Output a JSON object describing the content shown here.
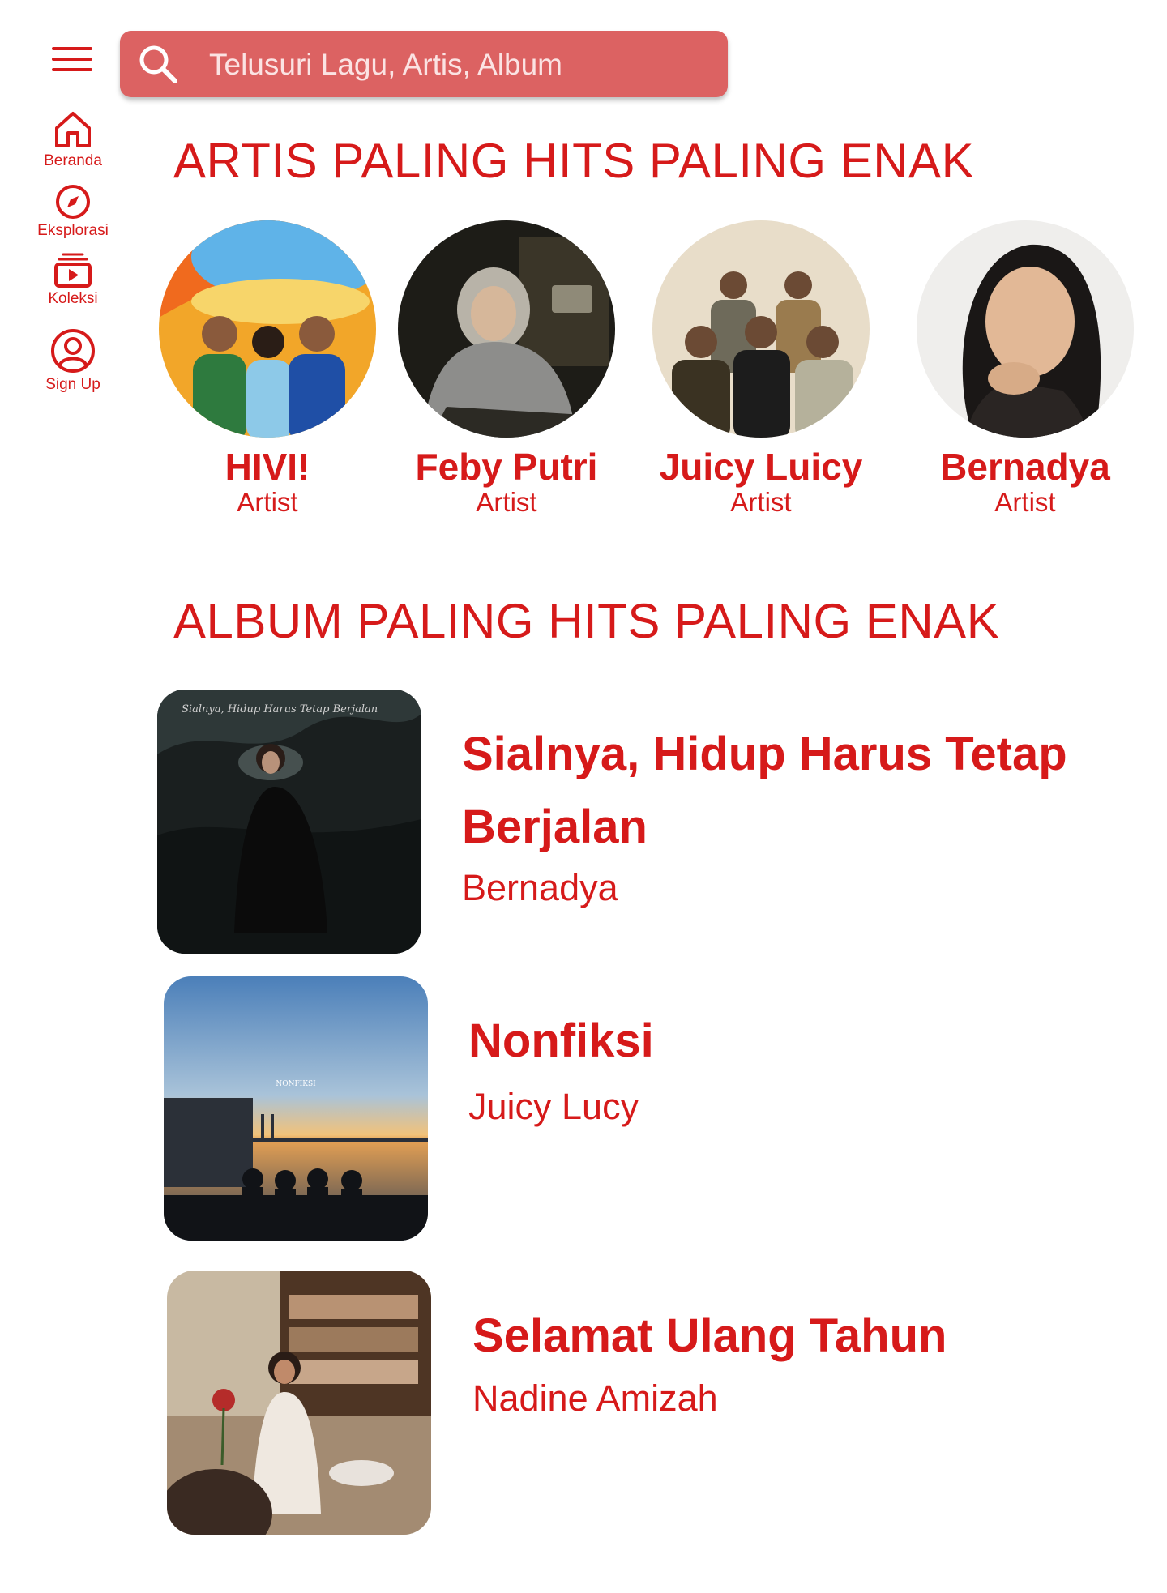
{
  "search": {
    "placeholder": "Telusuri Lagu, Artis, Album"
  },
  "sidebar": {
    "items": [
      {
        "label": "Beranda",
        "icon": "home-icon"
      },
      {
        "label": "Eksplorasi",
        "icon": "compass-icon"
      },
      {
        "label": "Koleksi",
        "icon": "library-icon"
      },
      {
        "label": "Sign Up",
        "icon": "user-circle-icon"
      }
    ]
  },
  "sections": {
    "artists_title": "ARTIS PALING HITS PALING ENAK",
    "albums_title": "ALBUM PALING HITS PALING ENAK"
  },
  "artists": [
    {
      "name": "HIVI!",
      "type": "Artist"
    },
    {
      "name": "Feby Putri",
      "type": "Artist"
    },
    {
      "name": "Juicy Luicy",
      "type": "Artist"
    },
    {
      "name": "Bernadya",
      "type": "Artist"
    }
  ],
  "albums": [
    {
      "title": "Sialnya, Hidup Harus Tetap Berjalan",
      "artist": "Bernadya",
      "cover_text": "Sialnya, Hidup Harus Tetap Berjalan"
    },
    {
      "title": "Nonfiksi",
      "artist": "Juicy Lucy",
      "cover_text": "NONFIKSI"
    },
    {
      "title": "Selamat Ulang Tahun",
      "artist": "Nadine Amizah"
    }
  ],
  "colors": {
    "accent": "#d61a1a",
    "search_bg": "#dc6262",
    "background": "#ffffff"
  }
}
